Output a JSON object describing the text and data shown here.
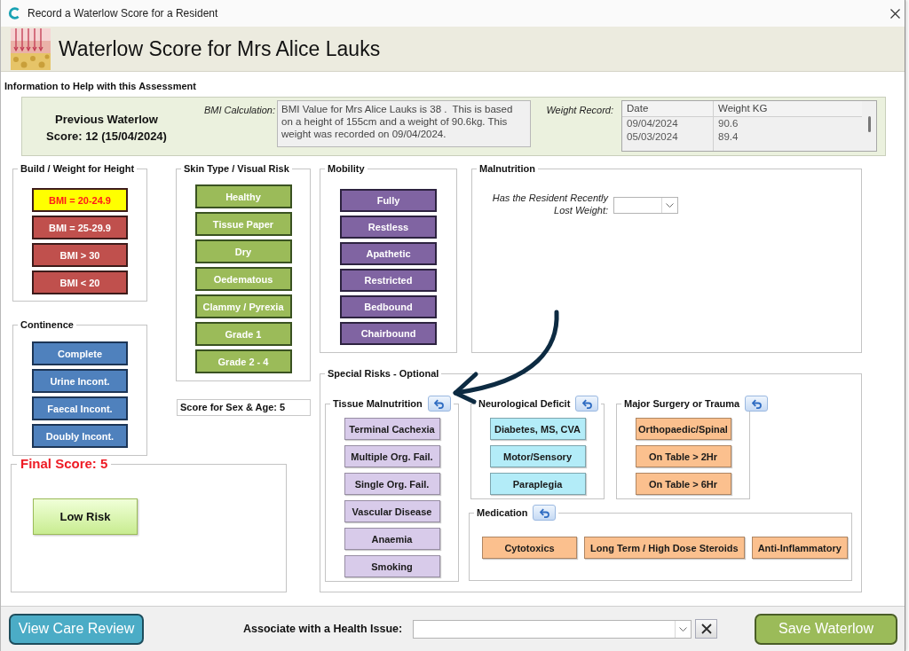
{
  "window": {
    "title": "Record a Waterlow Score for a Resident"
  },
  "header": {
    "title": "Waterlow Score for Mrs Alice Lauks"
  },
  "info": {
    "heading": "Information to Help with this Assessment",
    "previous_score": "Previous Waterlow Score: 12 (15/04/2024)",
    "bmi_label": "BMI Calculation:",
    "bmi_text": "BMI Value for Mrs Alice Lauks is 38 .  This is based on a height of 155cm and a weight of 90.6kg. This weight was recorded on 09/04/2024.",
    "weight_label": "Weight Record:",
    "weight_table": {
      "columns": [
        "Date",
        "Weight KG"
      ],
      "rows": [
        [
          "09/04/2024",
          "90.6"
        ],
        [
          "05/03/2024",
          "89.4"
        ]
      ]
    }
  },
  "build_weight": {
    "title": "Build / Weight for Height",
    "options": [
      {
        "label": "BMI = 20-24.9",
        "selected": true
      },
      {
        "label": "BMI = 25-29.9",
        "selected": false
      },
      {
        "label": "BMI > 30",
        "selected": false
      },
      {
        "label": "BMI < 20",
        "selected": false
      }
    ]
  },
  "continence": {
    "title": "Continence",
    "options": [
      {
        "label": "Complete",
        "selected": false
      },
      {
        "label": "Urine Incont.",
        "selected": false
      },
      {
        "label": "Faecal Incont.",
        "selected": false
      },
      {
        "label": "Doubly Incont.",
        "selected": false
      }
    ]
  },
  "skin_type": {
    "title": "Skin Type / Visual Risk",
    "options": [
      {
        "label": "Healthy",
        "selected": false
      },
      {
        "label": "Tissue Paper",
        "selected": false
      },
      {
        "label": "Dry",
        "selected": false
      },
      {
        "label": "Oedematous",
        "selected": false
      },
      {
        "label": "Clammy / Pyrexia",
        "selected": false
      },
      {
        "label": "Grade 1",
        "selected": false
      },
      {
        "label": "Grade 2 - 4",
        "selected": false
      }
    ]
  },
  "sex_age_score": "Score for Sex & Age: 5",
  "mobility": {
    "title": "Mobility",
    "options": [
      {
        "label": "Fully",
        "selected": false
      },
      {
        "label": "Restless",
        "selected": false
      },
      {
        "label": "Apathetic",
        "selected": false
      },
      {
        "label": "Restricted",
        "selected": false
      },
      {
        "label": "Bedbound",
        "selected": false
      },
      {
        "label": "Chairbound",
        "selected": false
      }
    ]
  },
  "malnutrition": {
    "title": "Malnutrition",
    "question": "Has the Resident Recently Lost Weight:"
  },
  "special_risks": {
    "title": "Special Risks - Optional",
    "groups": [
      {
        "title": "Tissue Malnutrition",
        "kind": "stack",
        "color": "#d8cbea",
        "options": [
          {
            "label": "Terminal Cachexia",
            "selected": false
          },
          {
            "label": "Multiple Org. Fail.",
            "selected": false
          },
          {
            "label": "Single Org. Fail.",
            "selected": false
          },
          {
            "label": "Vascular Disease",
            "selected": false
          },
          {
            "label": "Anaemia",
            "selected": false
          },
          {
            "label": "Smoking",
            "selected": false
          }
        ]
      },
      {
        "title": "Neurological Deficit",
        "kind": "stack",
        "color": "#b3ecf8",
        "options": [
          {
            "label": "Diabetes, MS, CVA",
            "selected": false
          },
          {
            "label": "Motor/Sensory",
            "selected": false
          },
          {
            "label": "Paraplegia",
            "selected": false
          }
        ]
      },
      {
        "title": "Major Surgery or Trauma",
        "kind": "stack",
        "color": "#fbc08e",
        "options": [
          {
            "label": "Orthopaedic/Spinal",
            "selected": false
          },
          {
            "label": "On Table > 2Hr",
            "selected": false
          },
          {
            "label": "On Table > 6Hr",
            "selected": false
          }
        ]
      },
      {
        "title": "Medication",
        "kind": "row",
        "color": "#fbc08e",
        "options": [
          {
            "label": "Cytotoxics",
            "selected": false
          },
          {
            "label": "Long Term / High Dose Steroids",
            "selected": false
          },
          {
            "label": "Anti-Inflammatory",
            "selected": false
          }
        ]
      }
    ]
  },
  "final_score": {
    "title": "Final Score: 5",
    "risk": "Low Risk"
  },
  "footer": {
    "view_button": "View Care Review",
    "health_issue_label": "Associate with a Health Issue:",
    "save_button": "Save Waterlow"
  }
}
